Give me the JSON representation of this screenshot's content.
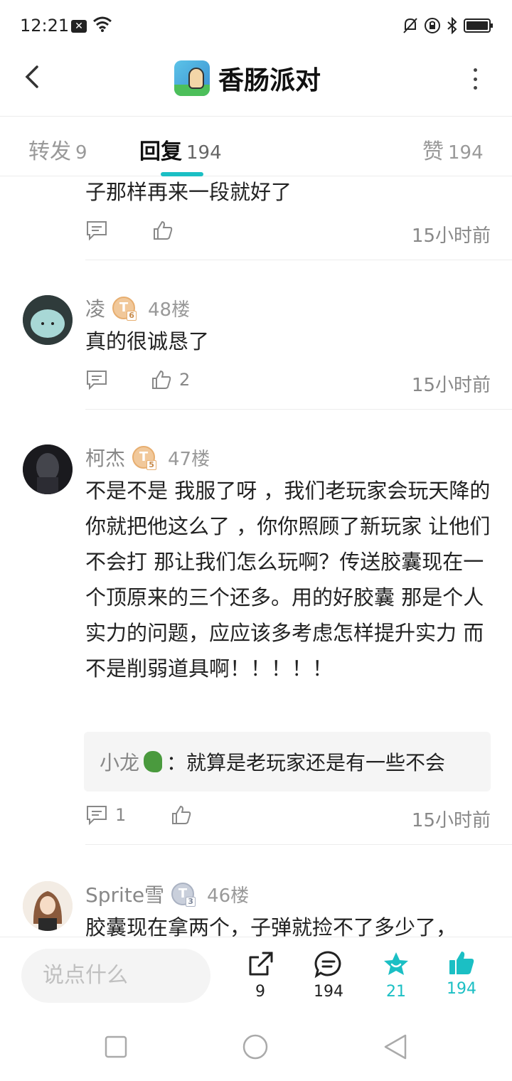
{
  "status_bar": {
    "time": "12:21"
  },
  "header": {
    "title": "香肠派对"
  },
  "tabs": [
    {
      "label": "转发",
      "count": "9"
    },
    {
      "label": "回复",
      "count": "194"
    },
    {
      "label": "赞",
      "count": "194"
    }
  ],
  "comments": [
    {
      "text": "子那样再来一段就好了",
      "likes": "",
      "time": "15小时前"
    },
    {
      "name": "凌",
      "level": "T",
      "level_sub": "6",
      "floor": "48楼",
      "text": "真的很诚恳了",
      "likes": "2",
      "time": "15小时前"
    },
    {
      "name": "柯杰",
      "level": "T",
      "level_sub": "5",
      "floor": "47楼",
      "text": "不是不是 我服了呀 ，我们老玩家会玩天降的 你就把他这么了 ，你你照顾了新玩家 让他们不会打 那让我们怎么玩啊？传送胶囊现在一个顶原来的三个还多。用的好胶囊 那是个人实力的问题，应应该多考虑怎样提升实力 而不是削弱道具啊！！！！！",
      "reply": {
        "name": "小龙",
        "text": "：就算是老玩家还是有一些不会"
      },
      "reply_count": "1",
      "time": "15小时前"
    },
    {
      "name": "Sprite雪",
      "level": "T",
      "level_sub": "3",
      "floor": "46楼",
      "text": "胶囊现在拿两个，子弹就捡不了多少了，"
    }
  ],
  "bottom_bar": {
    "input_placeholder": "说点什么",
    "share_count": "9",
    "comment_count": "194",
    "favorite_count": "21",
    "like_count": "194"
  },
  "colors": {
    "accent": "#1bbfc4"
  }
}
